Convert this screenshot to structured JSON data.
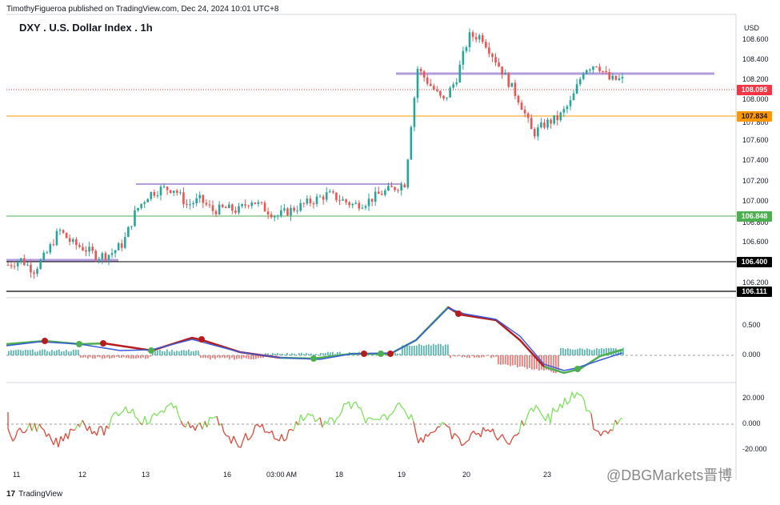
{
  "publisher": "TimothyFigueroa published on TradingView.com, Dec 24, 2024 10:01 UTC+8",
  "title": "DXY . U.S. Dollar Index . 1h",
  "currency": "USD",
  "price_axis": [
    "108.600",
    "108.400",
    "108.200",
    "108.000",
    "107.600",
    "107.400",
    "107.200",
    "107.000",
    "106.600",
    "106.200"
  ],
  "price_axis_partial": [
    "107.800",
    "106.800"
  ],
  "tags": [
    {
      "label": "108.095",
      "bg": "#f23645",
      "fg": "#ffffff"
    },
    {
      "label": "107.834",
      "bg": "#ff9800",
      "fg": "#131722"
    },
    {
      "label": "106.848",
      "bg": "#4caf50",
      "fg": "#ffffff"
    },
    {
      "label": "106.400",
      "bg": "#000000",
      "fg": "#ffffff"
    },
    {
      "label": "106.111",
      "bg": "#000000",
      "fg": "#ffffff"
    }
  ],
  "macd_axis": [
    "0.500",
    "0.000"
  ],
  "rsi_axis": [
    "20.000",
    "0.000",
    "-20.000"
  ],
  "time_axis": [
    "11",
    "12",
    "13",
    "16",
    "03:00 AM",
    "18",
    "19",
    "20",
    "23"
  ],
  "tradingview_logo": "TradingView",
  "watermark": "@DBGMarkets晋博",
  "colors": {
    "up": "#26a69a",
    "down": "#ef5350",
    "level": "#b39ddb",
    "rsi_up": "#7ee35a",
    "rsi_down": "#e0483b",
    "macd_fast": "#3a5bd9",
    "macd_slow_up": "#4caf50",
    "macd_slow_down": "#b71c1c"
  },
  "chart_data": {
    "type": "candlestick",
    "symbol": "DXY",
    "interval": "1h",
    "y_range": [
      106.1,
      108.7
    ],
    "horizontal_levels": [
      {
        "value": 108.095,
        "color": "#f23645",
        "style": "dotted"
      },
      {
        "value": 107.834,
        "color": "#ff9800",
        "style": "solid"
      },
      {
        "value": 106.848,
        "color": "#4caf50",
        "style": "solid"
      },
      {
        "value": 106.4,
        "color": "#000000",
        "style": "solid"
      },
      {
        "value": 106.111,
        "color": "#000000",
        "style": "solid"
      }
    ],
    "price_path": [
      106.4,
      106.45,
      106.35,
      106.5,
      106.72,
      106.6,
      106.55,
      106.48,
      106.5,
      106.6,
      106.9,
      107.05,
      107.1,
      107.1,
      106.95,
      107.0,
      106.9,
      106.92,
      106.9,
      107.0,
      106.92,
      106.85,
      106.9,
      106.95,
      107.0,
      107.05,
      107.0,
      106.95,
      106.98,
      107.05,
      107.1,
      107.15,
      108.2,
      108.05,
      107.9,
      108.1,
      108.5,
      108.5,
      108.3,
      108.1,
      107.9,
      107.6,
      107.7,
      107.75,
      107.9,
      108.2,
      108.25,
      108.1,
      108.1
    ]
  }
}
